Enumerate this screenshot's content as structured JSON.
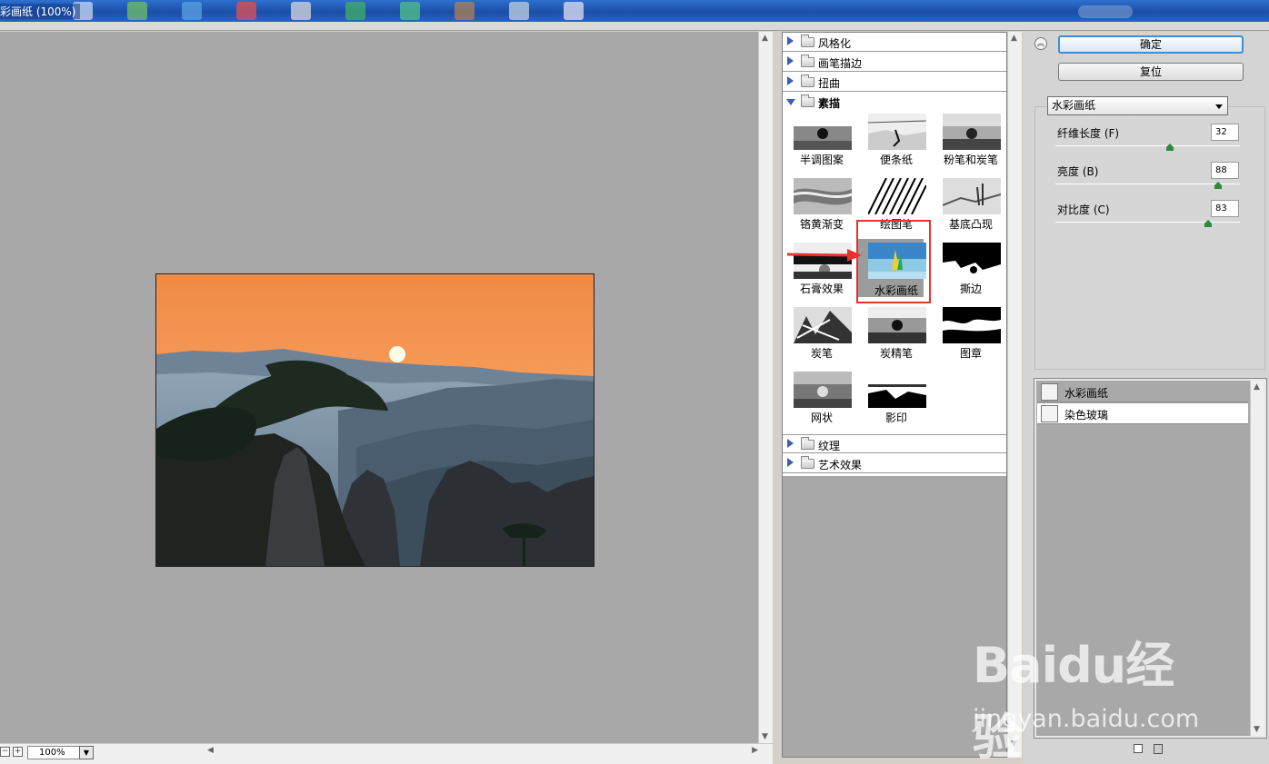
{
  "window": {
    "title": "彩画纸 (100%)"
  },
  "preview": {
    "zoom": "100%"
  },
  "filter_categories": {
    "stylize": "风格化",
    "brush_strokes": "画笔描边",
    "distort": "扭曲",
    "sketch": "素描",
    "texture": "纹理",
    "artistic": "艺术效果"
  },
  "sketch_filters": [
    "半调图案",
    "便条纸",
    "粉笔和炭笔",
    "铬黄渐变",
    "绘图笔",
    "基底凸现",
    "石膏效果",
    "水彩画纸",
    "撕边",
    "炭笔",
    "炭精笔",
    "图章",
    "网状",
    "影印"
  ],
  "selected_filter": "水彩画纸",
  "buttons": {
    "ok": "确定",
    "reset": "复位"
  },
  "filter_select": {
    "value": "水彩画纸"
  },
  "params": [
    {
      "label": "纤维长度 (F)",
      "value": "32"
    },
    {
      "label": "亮度 (B)",
      "value": "88"
    },
    {
      "label": "对比度 (C)",
      "value": "83"
    }
  ],
  "param_levels": [
    0.62,
    0.88,
    0.83
  ],
  "effect_layers": [
    {
      "name": "水彩画纸",
      "active": true
    },
    {
      "name": "染色玻璃",
      "active": false
    }
  ],
  "watermark": {
    "brand": "Baidu经验",
    "url": "jingyan.baidu.com"
  },
  "colors": {
    "accent": "#3c8fd8",
    "highlight_box": "#e8322d",
    "canvas_bg": "#a8a8a8"
  }
}
